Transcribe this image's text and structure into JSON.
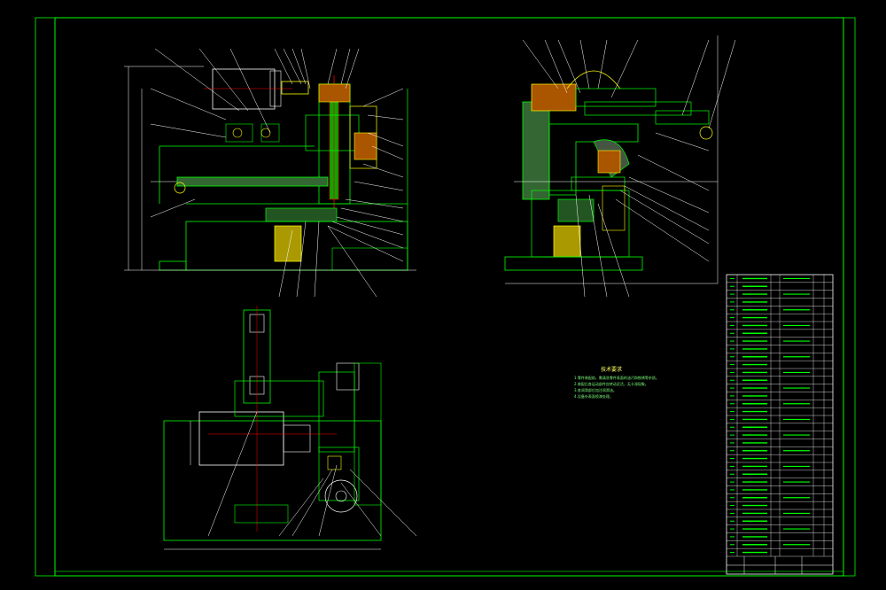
{
  "drawing": {
    "title": "",
    "colors": {
      "background": "#000000",
      "frame": "#00ff00",
      "part": "#00ff00",
      "section": "#ffff00",
      "leader": "#ffffff",
      "hatch": "#00ffff",
      "center": "#ff0000",
      "dim": "#ff00ff"
    }
  },
  "tech_requirements": {
    "title": "技术要求",
    "lines": [
      "1.零件装配前，需清洗零件表面的油污和铁锈等杂质。",
      "2.装配后各运动部件应转动灵活，无卡滞现象。",
      "3.各润滑部位加注润滑油。",
      "4.设备外表面喷漆处理。"
    ]
  },
  "title_block": {
    "rows": 36
  }
}
